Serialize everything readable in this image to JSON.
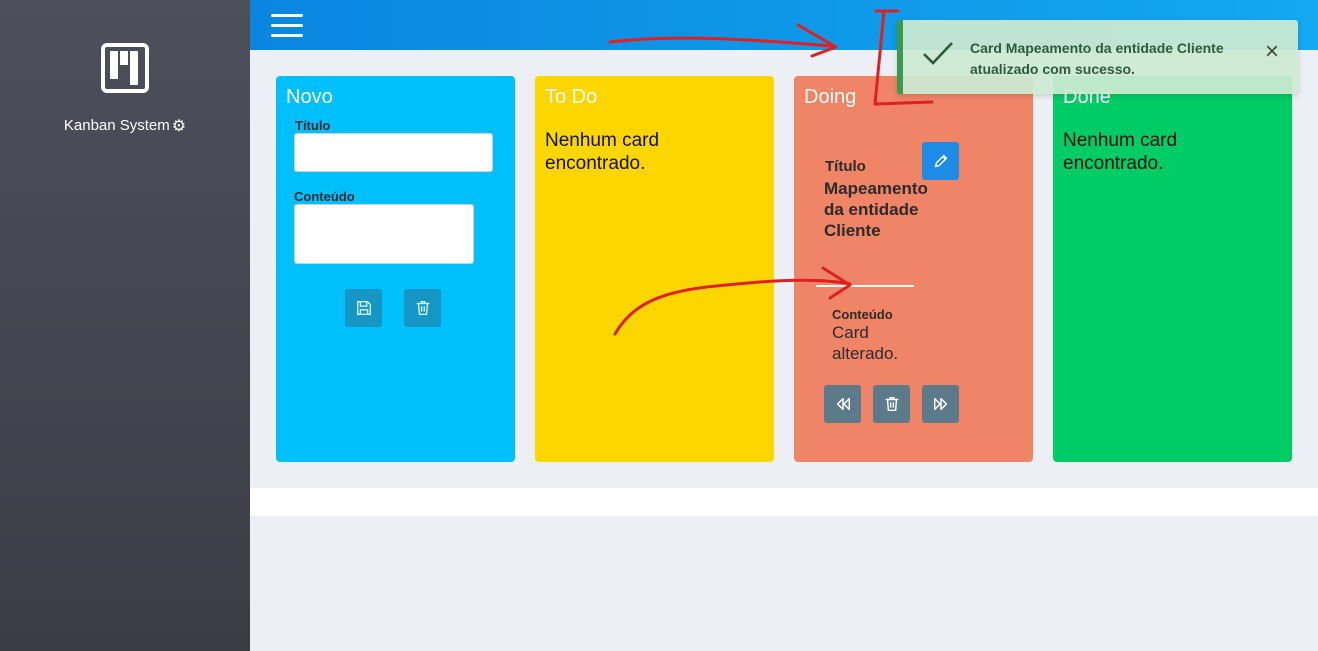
{
  "sidebar": {
    "brand_name": "Kanban System",
    "logo_icon": "kanban-board-icon",
    "settings_icon": "gear-icon"
  },
  "topbar": {
    "menu_icon": "hamburger-menu-icon"
  },
  "columns": {
    "novo": {
      "title": "Novo",
      "title_label": "Título",
      "content_label": "Conteúdo",
      "title_value": "",
      "content_value": "",
      "save_icon": "save-icon",
      "delete_icon": "trash-icon"
    },
    "todo": {
      "title": "To Do",
      "empty_text": "Nenhum card encontrado."
    },
    "doing": {
      "title": "Doing",
      "card": {
        "title_label": "Título",
        "title": "Mapeamento da entidade Cliente",
        "content_label": "Conteúdo",
        "content": "Card alterado.",
        "edit_icon": "pencil-icon",
        "back_icon": "rewind-icon",
        "delete_icon": "trash-icon",
        "forward_icon": "fast-forward-icon"
      }
    },
    "done": {
      "title": "Done",
      "empty_text": "Nenhum card encontrado."
    }
  },
  "toast": {
    "message": "Card Mapeamento da entidade Cliente atualizado com sucesso.",
    "check_icon": "check-icon",
    "close_icon": "close-icon"
  },
  "colors": {
    "novo": "#00c0fb",
    "todo": "#fdd600",
    "doing": "#f08466",
    "done": "#00cc66",
    "topbar": "#0a86e0",
    "annotation": "#e02020"
  }
}
